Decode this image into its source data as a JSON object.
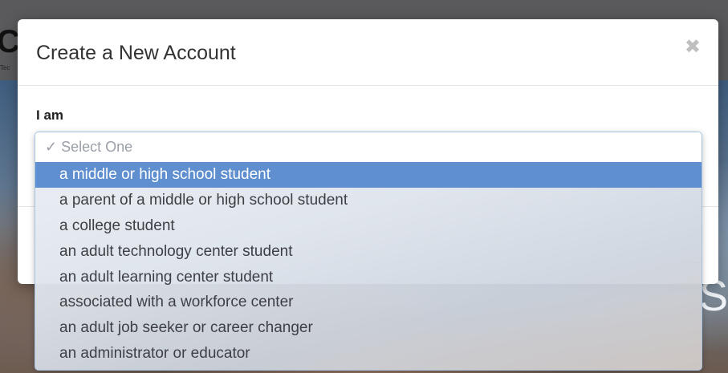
{
  "background": {
    "left_letter": "C",
    "left_small_text": "Tec",
    "right_letter": "S"
  },
  "modal": {
    "title": "Create a New Account",
    "close_icon": "close-icon",
    "field_label": "I am"
  },
  "select": {
    "placeholder": "✓ Select One",
    "highlight_color": "#5f8fcf",
    "options": [
      "a middle or high school student",
      "a parent of a middle or high school student",
      "a college student",
      "an adult technology center student",
      "an adult learning center student",
      "associated with a workforce center",
      "an adult job seeker or career changer",
      "an administrator or educator"
    ],
    "highlighted_index": 0
  }
}
